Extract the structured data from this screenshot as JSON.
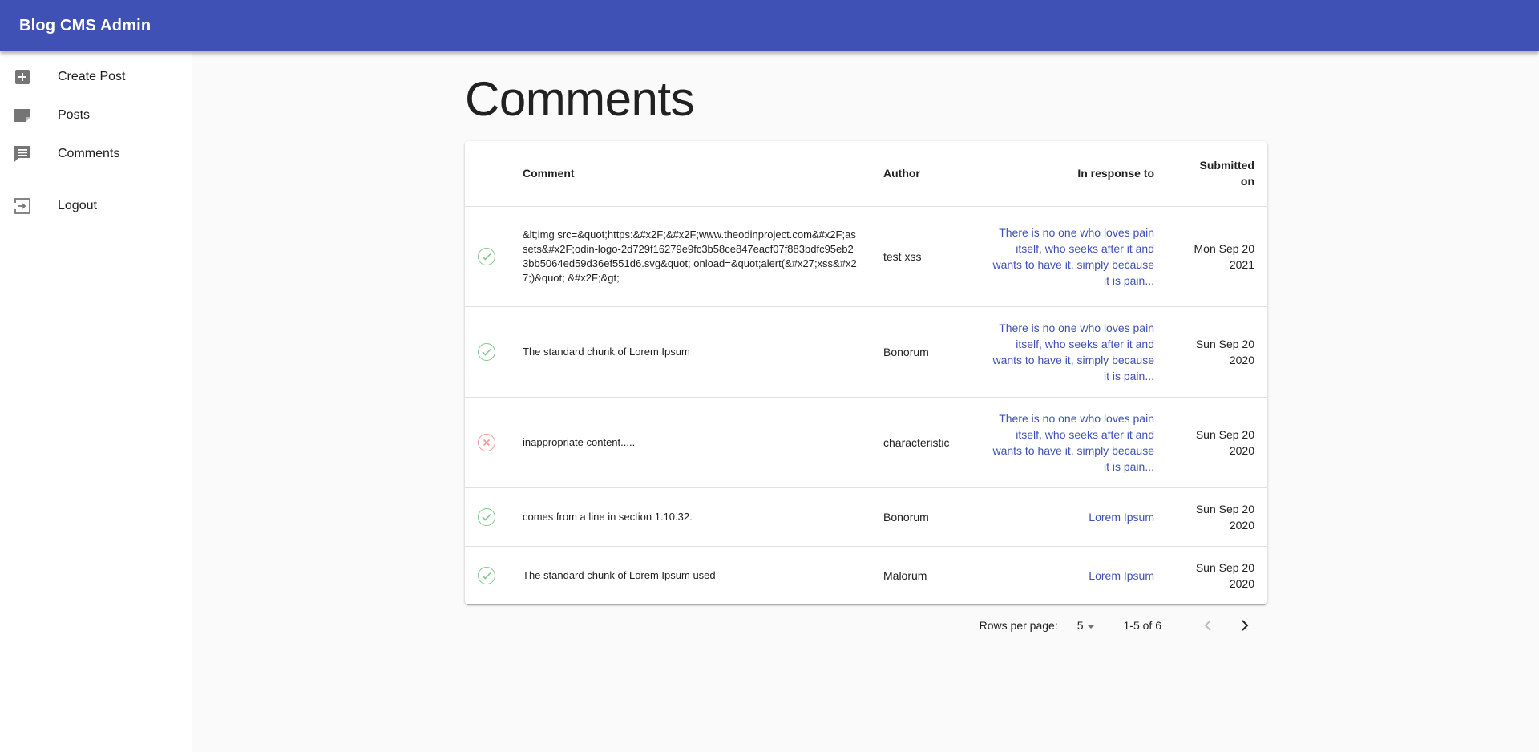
{
  "appbar": {
    "title": "Blog CMS Admin"
  },
  "nav": {
    "items": [
      {
        "label": "Create Post",
        "icon": "add-box-icon"
      },
      {
        "label": "Posts",
        "icon": "note-icon"
      },
      {
        "label": "Comments",
        "icon": "comment-icon"
      }
    ],
    "logout": {
      "label": "Logout",
      "icon": "logout-icon"
    }
  },
  "page": {
    "title": "Comments"
  },
  "table": {
    "headers": {
      "comment": "Comment",
      "author": "Author",
      "response": "In response to",
      "submitted_line1": "Submitted",
      "submitted_line2": "on"
    },
    "rows": [
      {
        "status": "approved",
        "comment": "&lt;img src=&quot;https:&#x2F;&#x2F;www.theodinproject.com&#x2F;assets&#x2F;odin-logo-2d729f16279e9fc3b58ce847eacf07f883bdfc95eb23bb5064ed59d36ef551d6.svg&quot; onload=&quot;alert(&#x27;xss&#x27;)&quot; &#x2F;&gt;",
        "author": "test xss",
        "response": "There is no one who loves pain itself, who seeks after it and wants to have it, simply because it is pain...",
        "date_line1": "Mon Sep 20",
        "date_line2": "2021"
      },
      {
        "status": "approved",
        "comment": "The standard chunk of Lorem Ipsum",
        "author": "Bonorum",
        "response": "There is no one who loves pain itself, who seeks after it and wants to have it, simply because it is pain...",
        "date_line1": "Sun Sep 20",
        "date_line2": "2020"
      },
      {
        "status": "rejected",
        "comment": "inappropriate content.....",
        "author": "characteristic",
        "response": "There is no one who loves pain itself, who seeks after it and wants to have it, simply because it is pain...",
        "date_line1": "Sun Sep 20",
        "date_line2": "2020"
      },
      {
        "status": "approved",
        "comment": "comes from a line in section 1.10.32.",
        "author": "Bonorum",
        "response": "Lorem Ipsum",
        "date_line1": "Sun Sep 20",
        "date_line2": "2020"
      },
      {
        "status": "approved",
        "comment": "The standard chunk of Lorem Ipsum used",
        "author": "Malorum",
        "response": "Lorem Ipsum",
        "date_line1": "Sun Sep 20",
        "date_line2": "2020"
      }
    ]
  },
  "pagination": {
    "rows_per_page_label": "Rows per page:",
    "rows_per_page_value": "5",
    "range": "1-5 of 6"
  },
  "colors": {
    "primary": "#3f51b5",
    "approved": "#81c784",
    "rejected": "#ef9a9a"
  }
}
